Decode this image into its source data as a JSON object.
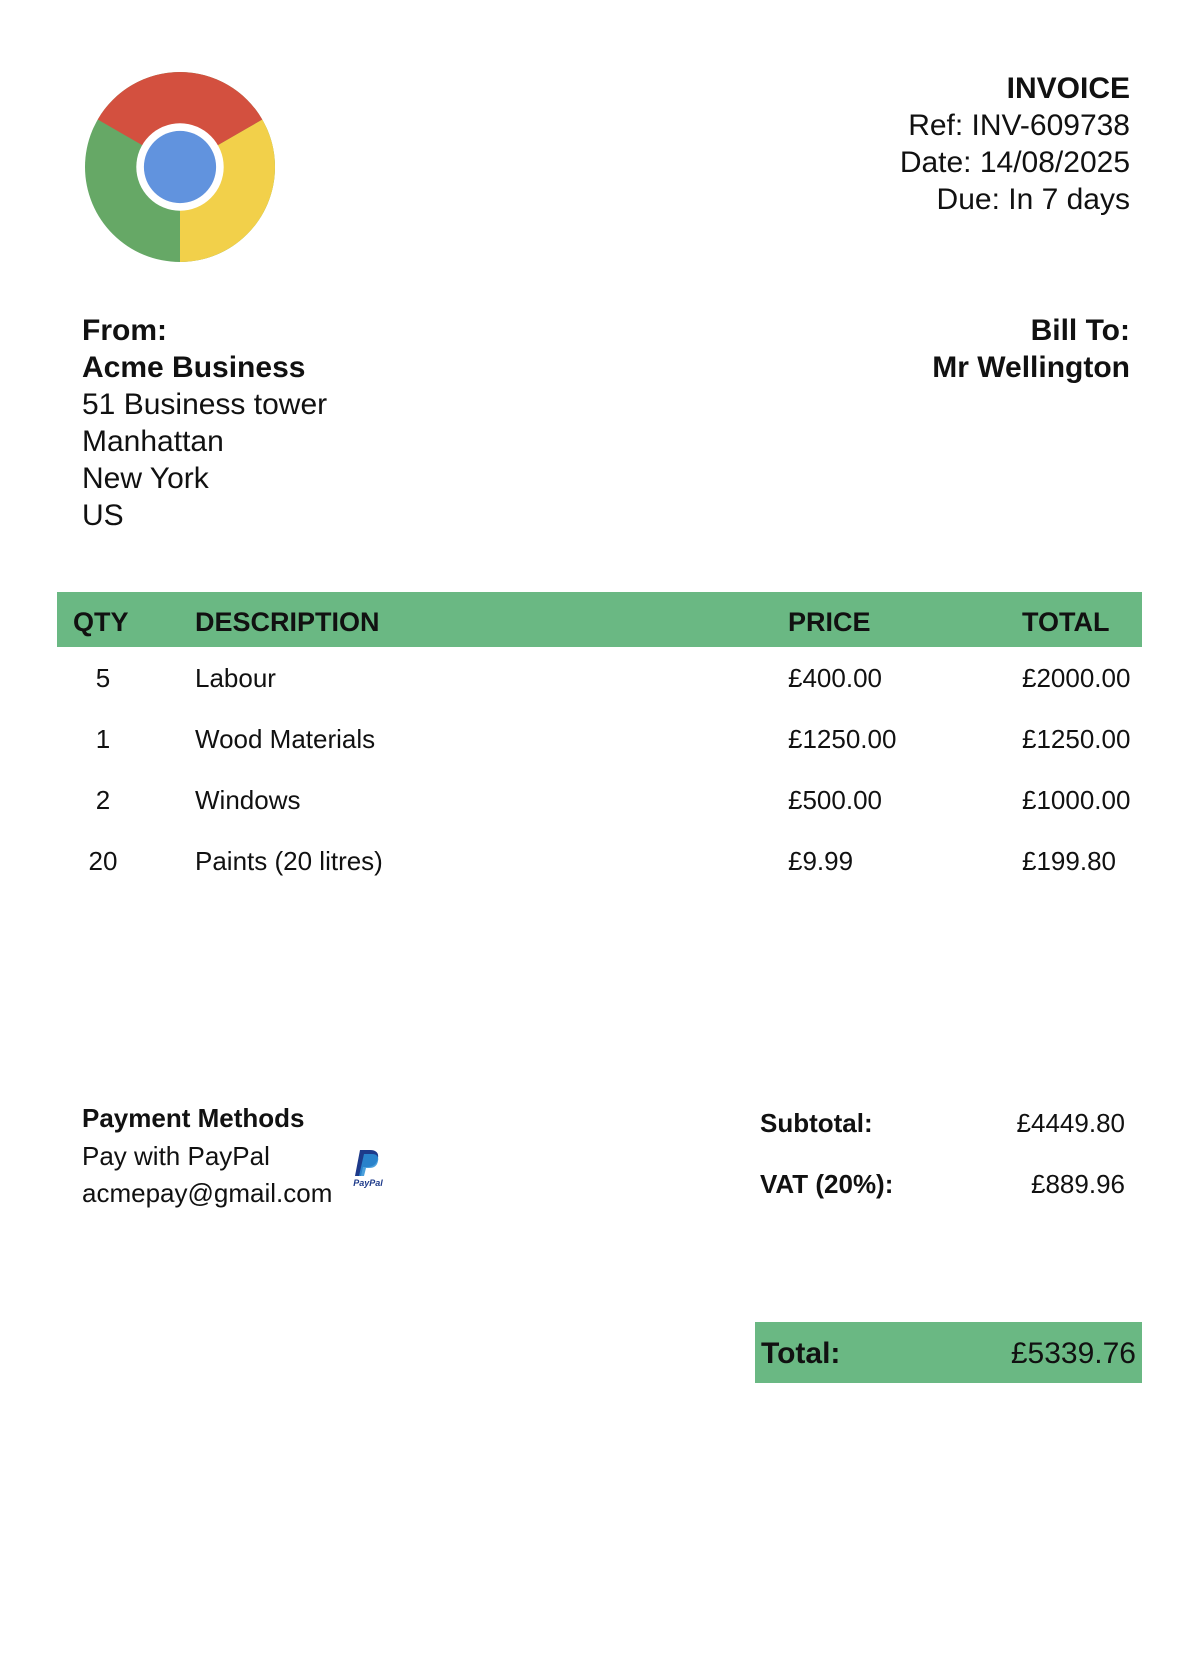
{
  "invoice": {
    "title": "INVOICE",
    "ref": "Ref: INV-609738",
    "date": "Date: 14/08/2025",
    "due": "Due: In 7 days"
  },
  "logo": {
    "icon": "chrome-logo-icon",
    "colors": {
      "red": "#d3503f",
      "yellow": "#f2d04a",
      "green": "#66a866",
      "blue": "#6193de"
    }
  },
  "from": {
    "label": "From:",
    "company": "Acme Business",
    "address": [
      "51 Business tower",
      "Manhattan",
      "New York",
      "US"
    ]
  },
  "bill_to": {
    "label": "Bill To:",
    "name": "Mr Wellington"
  },
  "table": {
    "header_color": "#6ab883",
    "columns": [
      "QTY",
      "DESCRIPTION",
      "PRICE",
      "TOTAL"
    ],
    "rows": [
      {
        "qty": "5",
        "description": "Labour",
        "price": "£400.00",
        "total": "£2000.00"
      },
      {
        "qty": "1",
        "description": "Wood Materials",
        "price": "£1250.00",
        "total": "£1250.00"
      },
      {
        "qty": "2",
        "description": "Windows",
        "price": "£500.00",
        "total": "£1000.00"
      },
      {
        "qty": "20",
        "description": "Paints (20 litres)",
        "price": "£9.99",
        "total": "£199.80"
      }
    ]
  },
  "payment": {
    "heading": "Payment Methods",
    "method": "Pay with PayPal",
    "email": "acmepay@gmail.com",
    "icon": "paypal-icon",
    "icon_text": "PayPal"
  },
  "summary": {
    "subtotal_label": "Subtotal:",
    "subtotal_value": "£4449.80",
    "vat_label": "VAT (20%):",
    "vat_value": "£889.96",
    "total_label": "Total:",
    "total_value": "£5339.76"
  }
}
